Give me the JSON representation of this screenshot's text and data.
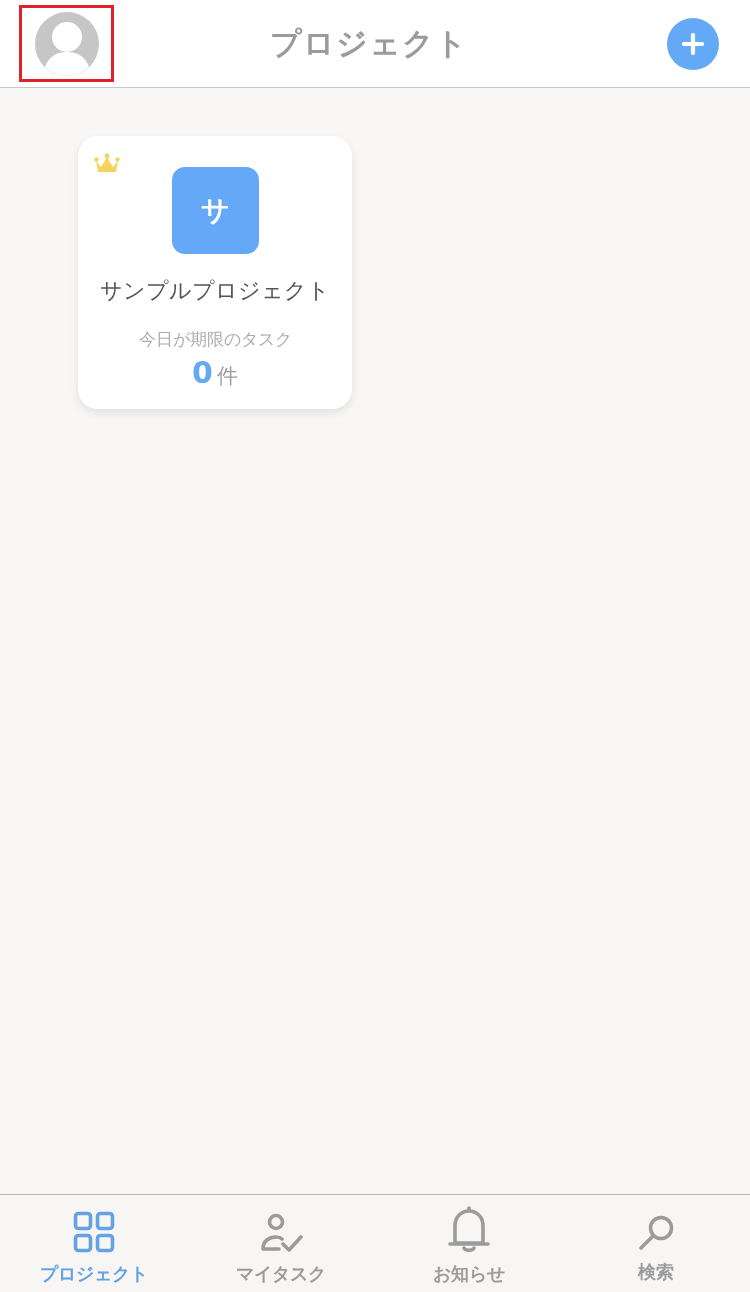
{
  "header": {
    "avatar": {
      "highlighted": true
    },
    "title": "プロジェクト"
  },
  "projects": [
    {
      "crowned": true,
      "initial": "サ",
      "color": "#65a8f7",
      "name": "サンプルプロジェクト",
      "due_label": "今日が期限のタスク",
      "due_count": "0",
      "due_unit": "件"
    }
  ],
  "tabs": [
    {
      "label": "プロジェクト",
      "selected": true
    },
    {
      "label": "マイタスク",
      "selected": false
    },
    {
      "label": "お知らせ",
      "selected": false
    },
    {
      "label": "検索",
      "selected": false
    }
  ]
}
